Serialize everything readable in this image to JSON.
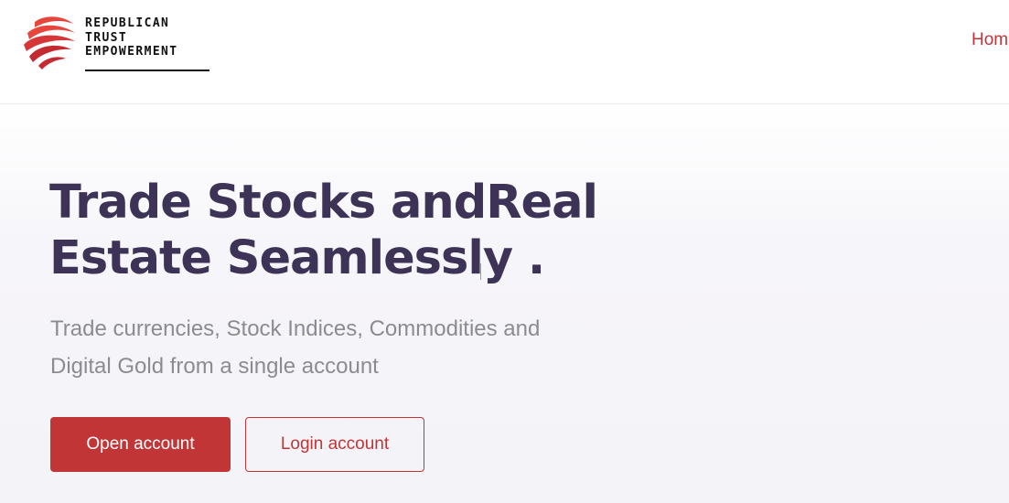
{
  "header": {
    "logo": {
      "line1": "REPUBLICAN",
      "line2": "TRUST",
      "line3": "EMPOWERMENT",
      "mark_colors": [
        "#e8453c",
        "#c42a30"
      ]
    },
    "nav": {
      "home_label": "Hom"
    }
  },
  "hero": {
    "title_line1": "Trade Stocks andReal",
    "title_line2": "Estate Seamlessly .",
    "subtitle_line1": "Trade currencies, Stock Indices, Commodities and",
    "subtitle_line2": "Digital Gold from a single account",
    "primary_button_label": "Open account",
    "secondary_button_label": "Login account"
  },
  "colors": {
    "accent": "#c23536",
    "title": "#3c3356",
    "subtitle": "#8b8b91"
  }
}
